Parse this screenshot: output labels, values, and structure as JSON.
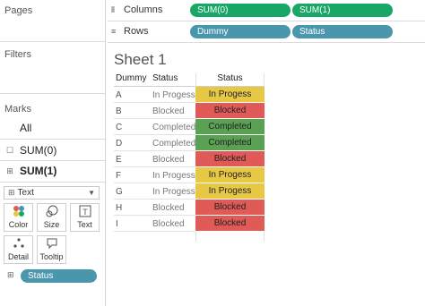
{
  "left": {
    "pages_title": "Pages",
    "filters_title": "Filters",
    "marks_title": "Marks",
    "marks_items": [
      {
        "label": "All"
      },
      {
        "label": "SUM(0)"
      },
      {
        "label": "SUM(1)"
      }
    ],
    "mark_type": "Text",
    "mark_buttons": [
      {
        "label": "Color",
        "icon": "color-palette-icon"
      },
      {
        "label": "Size",
        "icon": "size-icon"
      },
      {
        "label": "Text",
        "icon": "text-icon"
      },
      {
        "label": "Detail",
        "icon": "detail-icon"
      },
      {
        "label": "Tooltip",
        "icon": "tooltip-icon"
      }
    ],
    "status_pill": "Status"
  },
  "shelves": {
    "columns_label": "Columns",
    "columns_pills": [
      "SUM(0)",
      "SUM(1)"
    ],
    "rows_label": "Rows",
    "rows_pills": [
      "Dummy",
      "Status"
    ]
  },
  "sheet": {
    "title": "Sheet 1",
    "headers": {
      "dummy": "Dummy",
      "status1": "Status",
      "status2": "Status"
    },
    "rows": [
      {
        "dummy": "A",
        "status": "In Progess",
        "value": "In Progess"
      },
      {
        "dummy": "B",
        "status": "Blocked",
        "value": "Blocked"
      },
      {
        "dummy": "C",
        "status": "Completed",
        "value": "Completed"
      },
      {
        "dummy": "D",
        "status": "Completed",
        "value": "Completed"
      },
      {
        "dummy": "E",
        "status": "Blocked",
        "value": "Blocked"
      },
      {
        "dummy": "F",
        "status": "In Progess",
        "value": "In Progess"
      },
      {
        "dummy": "G",
        "status": "In Progess",
        "value": "In Progess"
      },
      {
        "dummy": "H",
        "status": "Blocked",
        "value": "Blocked"
      },
      {
        "dummy": "I",
        "status": "Blocked",
        "value": "Blocked"
      }
    ]
  },
  "colors": {
    "in_progress": "#e7c845",
    "blocked": "#e05a57",
    "completed": "#5aa154",
    "pill_blue": "#4a96ad",
    "pill_green": "#18a766"
  }
}
